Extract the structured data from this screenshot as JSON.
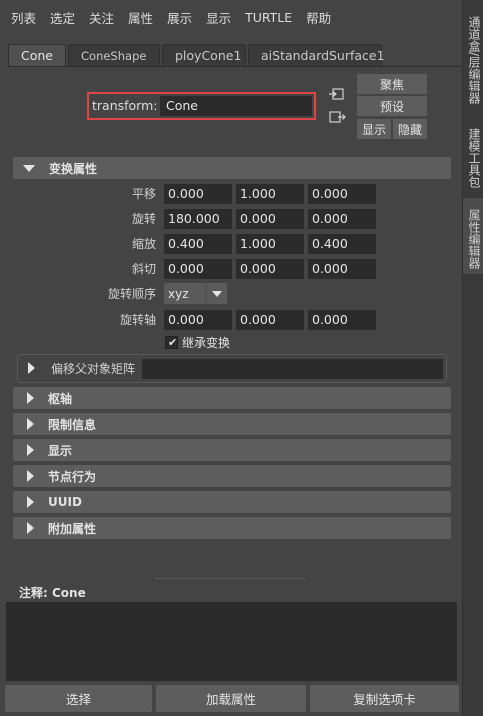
{
  "menu": [
    "列表",
    "选定",
    "关注",
    "属性",
    "展示",
    "显示",
    "TURTLE",
    "帮助"
  ],
  "side_tabs": [
    "通道盒/层编辑器",
    "建模工具包",
    "属性编辑器"
  ],
  "node_tabs": [
    "Cone",
    "ConeShape",
    "ployCone1",
    "aiStandardSurface1"
  ],
  "transform": {
    "label": "transform:",
    "value": "Cone"
  },
  "buttons": {
    "focus": "聚焦",
    "preset": "预设",
    "show": "显示",
    "hide": "隐藏"
  },
  "sections": {
    "transform_attrs": "变换属性",
    "offset_parent": "偏移父对象矩阵",
    "pivot": "枢轴",
    "limit_info": "限制信息",
    "display": "显示",
    "node_behavior": "节点行为",
    "uuid": "UUID",
    "extra_attrs": "附加属性"
  },
  "attrs": {
    "translate": {
      "label": "平移",
      "values": [
        "0.000",
        "1.000",
        "0.000"
      ]
    },
    "rotate": {
      "label": "旋转",
      "values": [
        "180.000",
        "0.000",
        "0.000"
      ]
    },
    "scale": {
      "label": "缩放",
      "values": [
        "0.400",
        "1.000",
        "0.400"
      ]
    },
    "shear": {
      "label": "斜切",
      "values": [
        "0.000",
        "0.000",
        "0.000"
      ]
    },
    "rotate_order": {
      "label": "旋转顺序",
      "value": "xyz"
    },
    "rotate_axis": {
      "label": "旋转轴",
      "values": [
        "0.000",
        "0.000",
        "0.000"
      ]
    },
    "inherit": {
      "label": "继承变换",
      "checked": true
    }
  },
  "notes": {
    "label": "注释:  Cone"
  },
  "bottom": {
    "select": "选择",
    "load_attrs": "加载属性",
    "copy_tab": "复制选项卡"
  }
}
